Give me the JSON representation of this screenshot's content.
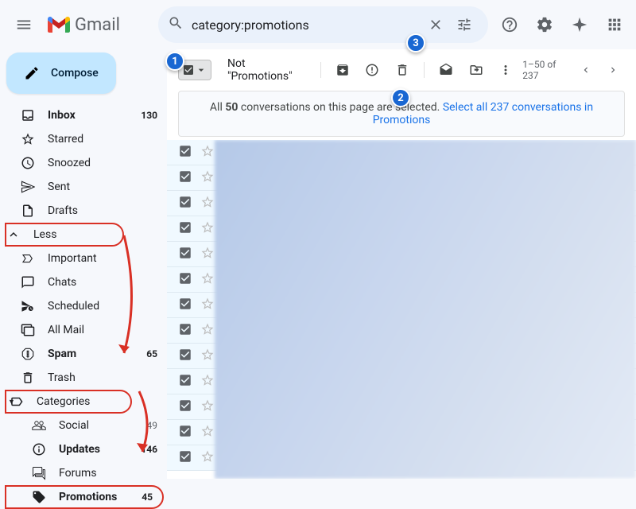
{
  "header": {
    "app_name": "Gmail",
    "search_value": "category:promotions"
  },
  "compose": {
    "label": "Compose"
  },
  "sidebar": {
    "inbox": {
      "label": "Inbox",
      "count": "130"
    },
    "starred": {
      "label": "Starred"
    },
    "snoozed": {
      "label": "Snoozed"
    },
    "sent": {
      "label": "Sent"
    },
    "drafts": {
      "label": "Drafts"
    },
    "less": {
      "label": "Less"
    },
    "important": {
      "label": "Important"
    },
    "chats": {
      "label": "Chats"
    },
    "scheduled": {
      "label": "Scheduled"
    },
    "allmail": {
      "label": "All Mail"
    },
    "spam": {
      "label": "Spam",
      "count": "65"
    },
    "trash": {
      "label": "Trash"
    },
    "categories": {
      "label": "Categories"
    },
    "social": {
      "label": "Social",
      "count": "49"
    },
    "updates": {
      "label": "Updates",
      "count": "146"
    },
    "forums": {
      "label": "Forums"
    },
    "promotions": {
      "label": "Promotions",
      "count": "45"
    }
  },
  "toolbar": {
    "not_promotions": "Not \"Promotions\"",
    "pagination": "1–50 of 237"
  },
  "banner": {
    "text_prefix": "All ",
    "count": "50",
    "text_mid": " conversations on this page are selected. ",
    "link": "Select all 237 conversations in Promotions"
  },
  "annotations": {
    "a1": "1",
    "a2": "2",
    "a3": "3"
  }
}
